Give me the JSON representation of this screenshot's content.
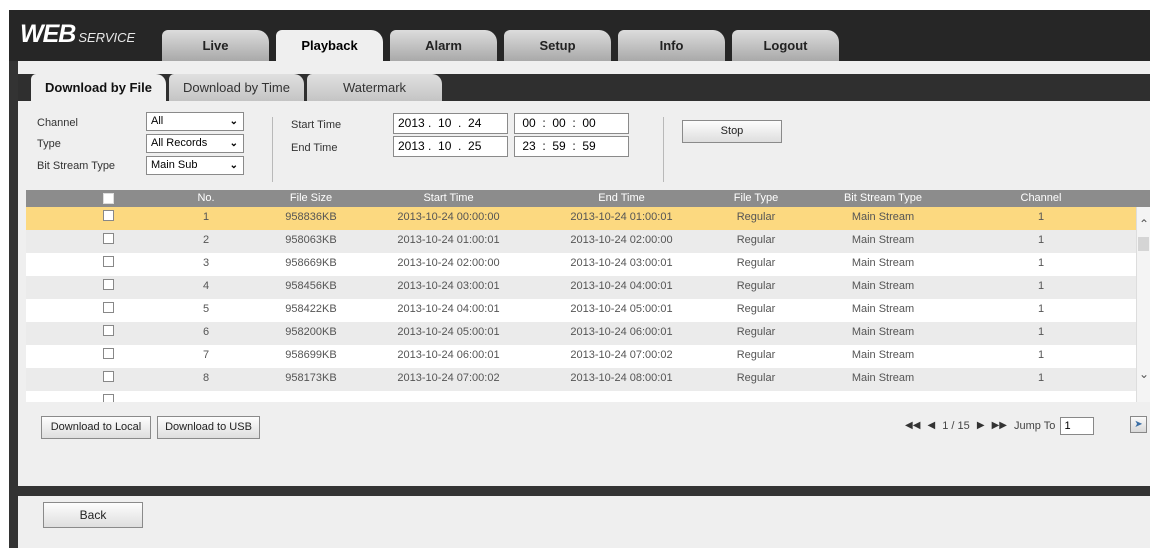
{
  "logo": {
    "web": "WEB",
    "service": "SERVICE"
  },
  "nav": [
    "Live",
    "Playback",
    "Alarm",
    "Setup",
    "Info",
    "Logout"
  ],
  "sub_tabs": [
    "Download by File",
    "Download by Time",
    "Watermark"
  ],
  "filters": {
    "channel_label": "Channel",
    "channel_value": "All",
    "type_label": "Type",
    "type_value": "All Records",
    "bitstream_label": "Bit Stream Type",
    "bitstream_value": "Main Sub",
    "start_label": "Start Time",
    "end_label": "End Time",
    "start_date": "2013 .  10  .  24",
    "start_time": " 00  :  00  :  00",
    "end_date": "2013 .  10  .  25",
    "end_time": " 23  :  59  :  59",
    "stop_label": "Stop"
  },
  "table": {
    "headers": [
      "No.",
      "File Size",
      "Start Time",
      "End Time",
      "File Type",
      "Bit Stream Type",
      "Channel"
    ],
    "rows": [
      [
        "1",
        "958836KB",
        "2013-10-24 00:00:00",
        "2013-10-24 01:00:01",
        "Regular",
        "Main Stream",
        "1"
      ],
      [
        "2",
        "958063KB",
        "2013-10-24 01:00:01",
        "2013-10-24 02:00:00",
        "Regular",
        "Main Stream",
        "1"
      ],
      [
        "3",
        "958669KB",
        "2013-10-24 02:00:00",
        "2013-10-24 03:00:01",
        "Regular",
        "Main Stream",
        "1"
      ],
      [
        "4",
        "958456KB",
        "2013-10-24 03:00:01",
        "2013-10-24 04:00:01",
        "Regular",
        "Main Stream",
        "1"
      ],
      [
        "5",
        "958422KB",
        "2013-10-24 04:00:01",
        "2013-10-24 05:00:01",
        "Regular",
        "Main Stream",
        "1"
      ],
      [
        "6",
        "958200KB",
        "2013-10-24 05:00:01",
        "2013-10-24 06:00:01",
        "Regular",
        "Main Stream",
        "1"
      ],
      [
        "7",
        "958699KB",
        "2013-10-24 06:00:01",
        "2013-10-24 07:00:02",
        "Regular",
        "Main Stream",
        "1"
      ],
      [
        "8",
        "958173KB",
        "2013-10-24 07:00:02",
        "2013-10-24 08:00:01",
        "Regular",
        "Main Stream",
        "1"
      ]
    ]
  },
  "actions": {
    "download_local": "Download to Local",
    "download_usb": "Download to USB",
    "back": "Back"
  },
  "pager": {
    "page_text": "1 / 15",
    "jump_label": "Jump To",
    "jump_value": "1"
  },
  "colors": {
    "selected_row": "#fcd980",
    "header_bg": "#262626",
    "table_header": "#8c8c8c"
  }
}
